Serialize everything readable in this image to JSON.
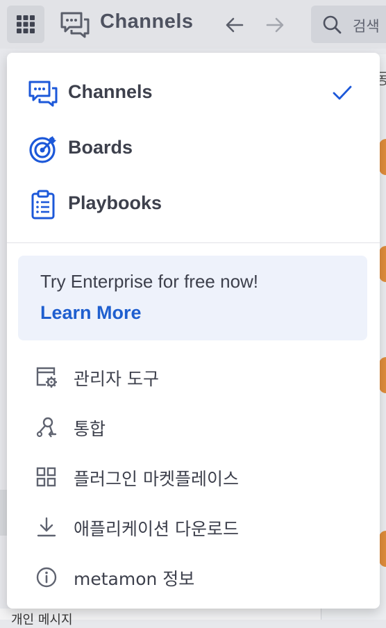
{
  "topbar": {
    "title": "Channels",
    "search_placeholder": "검색"
  },
  "background": {
    "bottom_text": "개인 메시지",
    "right_char": "동"
  },
  "menu": {
    "products": [
      {
        "label": "Channels",
        "icon": "channels-icon",
        "selected": true
      },
      {
        "label": "Boards",
        "icon": "boards-icon",
        "selected": false
      },
      {
        "label": "Playbooks",
        "icon": "playbooks-icon",
        "selected": false
      }
    ],
    "promo": {
      "text": "Try Enterprise for free now!",
      "link": "Learn More"
    },
    "items": [
      {
        "label": "관리자 도구",
        "icon": "admin-console-icon"
      },
      {
        "label": "통합",
        "icon": "integrations-icon"
      },
      {
        "label": "플러그인 마켓플레이스",
        "icon": "marketplace-icon"
      },
      {
        "label": "애플리케이션 다운로드",
        "icon": "download-icon"
      },
      {
        "label": "metamon 정보",
        "icon": "info-icon"
      }
    ]
  },
  "colors": {
    "accent": "#1f5fcf",
    "icon_blue": "#1c58d9",
    "promo_bg": "#eef2fb",
    "orange": "#e08d3c"
  }
}
